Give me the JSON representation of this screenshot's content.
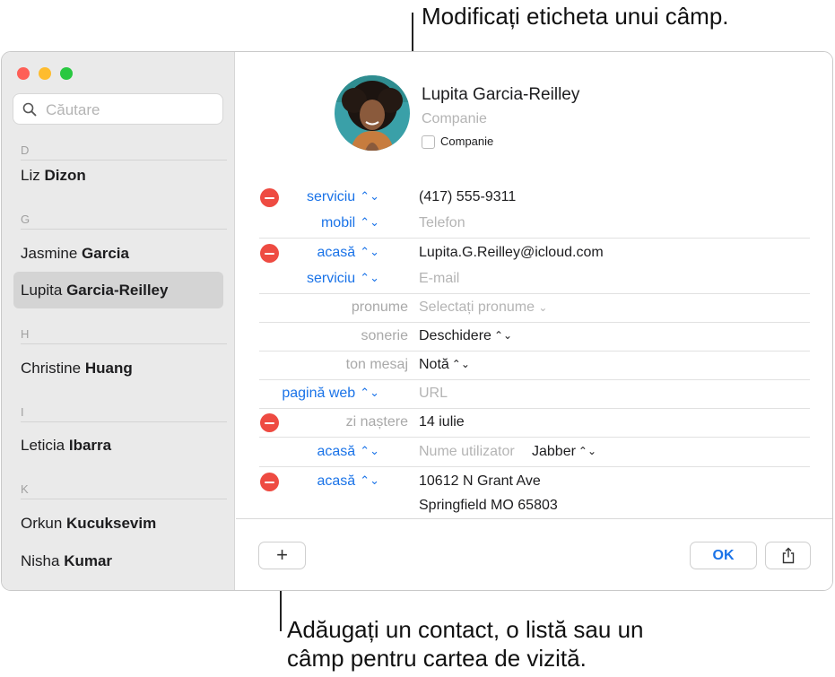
{
  "callouts": {
    "top": "Modificați eticheta unui câmp.",
    "bottom_line1": "Adăugați un contact, o listă sau un",
    "bottom_line2": "câmp pentru cartea de vizită."
  },
  "sidebar": {
    "search_placeholder": "Căutare",
    "sections": [
      {
        "letter": "D"
      },
      {
        "letter": "G"
      },
      {
        "letter": "H"
      },
      {
        "letter": "I"
      },
      {
        "letter": "K"
      }
    ],
    "contacts": [
      {
        "first": "Liz",
        "last": "Dizon"
      },
      {
        "first": "Jasmine",
        "last": "Garcia"
      },
      {
        "first": "Lupita",
        "last": "Garcia-Reilley",
        "selected": true
      },
      {
        "first": "Christine",
        "last": "Huang"
      },
      {
        "first": "Leticia",
        "last": "Ibarra"
      },
      {
        "first": "Orkun",
        "last": "Kucuksevim"
      },
      {
        "first": "Nisha",
        "last": "Kumar"
      }
    ]
  },
  "card": {
    "name": "Lupita  Garcia-Reilley",
    "company_placeholder": "Companie",
    "company_checkbox_label": "Companie",
    "fields": [
      {
        "label": "serviciu",
        "value": "(417) 555-9311"
      },
      {
        "label": "mobil",
        "placeholder": "Telefon"
      },
      {
        "label": "acasă",
        "value": "Lupita.G.Reilley@icloud.com"
      },
      {
        "label": "serviciu",
        "placeholder": "E-mail"
      },
      {
        "label": "pronume",
        "placeholder": "Selectați pronume"
      },
      {
        "label": "sonerie",
        "value": "Deschidere"
      },
      {
        "label": "ton mesaj",
        "value": "Notă"
      },
      {
        "label": "pagină web",
        "placeholder": "URL"
      },
      {
        "label": "zi naștere",
        "value": "14 iulie"
      },
      {
        "label": "acasă",
        "placeholder": "Nume utilizator",
        "value": "Jabber"
      },
      {
        "label": "acasă",
        "value": "10612 N Grant Ave",
        "value2": "Springfield MO 65803"
      }
    ]
  },
  "footer": {
    "add_label": "+",
    "ok_label": "OK"
  },
  "colors": {
    "accent": "#1a73e8",
    "remove": "#ee4b42",
    "sidebar_bg": "#eaeaea",
    "selected_row": "#d4d4d4"
  },
  "icons": {
    "search": "magnifier-icon",
    "remove": "minus-circle-icon",
    "stepper": "up-down-chevron-icon",
    "dropdown": "chevron-down-icon",
    "share": "share-icon"
  }
}
